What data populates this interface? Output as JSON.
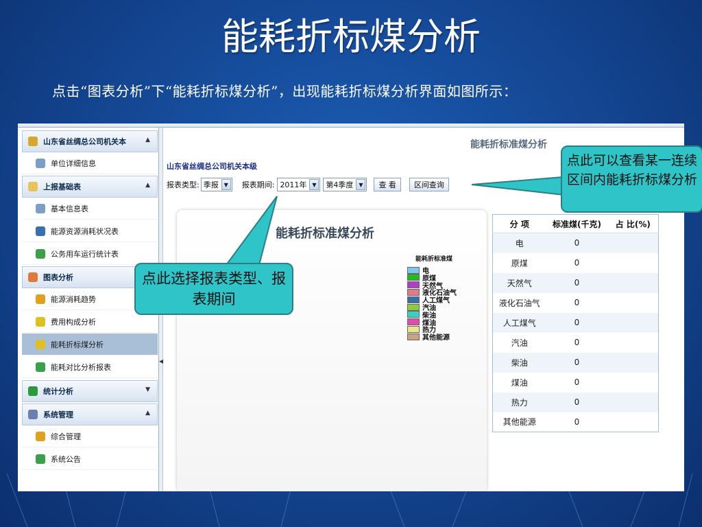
{
  "slide": {
    "title": "能耗折标煤分析",
    "subtitle": "点击“图表分析”下“能耗折标煤分析”，出现能耗折标煤分析界面如图所示："
  },
  "sidebar": {
    "sections": [
      {
        "label": "山东省丝绸总公司机关本",
        "caret": "▲",
        "icon_color": "#d7a92a",
        "items": [
          {
            "label": "单位详细信息",
            "icon_color": "#7aa0c8"
          }
        ]
      },
      {
        "label": "上报基础表",
        "caret": "▲",
        "icon_color": "#e8c35a",
        "items": [
          {
            "label": "基本信息表",
            "icon_color": "#7aa0c8"
          },
          {
            "label": "能源资源消耗状况表",
            "icon_color": "#3a6fb0"
          },
          {
            "label": "公务用车运行统计表",
            "icon_color": "#3aa04a"
          }
        ]
      },
      {
        "label": "图表分析",
        "caret": "",
        "icon_color": "#e07a3a",
        "items": [
          {
            "label": "能源消耗趋势",
            "icon_color": "#e0a020"
          },
          {
            "label": "费用构成分析",
            "icon_color": "#e0c020"
          },
          {
            "label": "能耗折标煤分析",
            "icon_color": "#e0c020",
            "active": true
          },
          {
            "label": "能耗对比分析报表",
            "icon_color": "#3aa04a"
          }
        ]
      },
      {
        "label": "统计分析",
        "caret": "▼",
        "icon_color": "#2a9a3a",
        "items": []
      },
      {
        "label": "系统管理",
        "caret": "▲",
        "icon_color": "#6a7fb0",
        "items": [
          {
            "label": "综合管理",
            "icon_color": "#e0a020"
          },
          {
            "label": "系统公告",
            "icon_color": "#3aa04a"
          }
        ]
      }
    ]
  },
  "main": {
    "header": "能耗折标准煤分析",
    "org_name": "山东省丝绸总公司机关本级",
    "form": {
      "type_label": "报表类型:",
      "type_value": "季报",
      "period_label": "报表期间:",
      "year_value": "2011年",
      "quarter_value": "第4季度",
      "view_button": "查 看",
      "range_button": "区间查询"
    },
    "chart_title": "能耗折标准煤分析"
  },
  "chart_data": {
    "type": "pie",
    "title": "能耗折标准煤分析",
    "legend_title": "能耗折标准煤",
    "legend_position": "right",
    "categories": [
      "电",
      "原煤",
      "天然气",
      "液化石油气",
      "人工煤气",
      "汽油",
      "柴油",
      "煤油",
      "热力",
      "其他能源"
    ],
    "values": [
      0,
      0,
      0,
      0,
      0,
      0,
      0,
      0,
      0,
      0
    ],
    "colors": [
      "#7ec8ee",
      "#22bb22",
      "#b03ec8",
      "#e07a86",
      "#3a6ea8",
      "#8ccc3a",
      "#3ad0c4",
      "#e84aa8",
      "#eee48a",
      "#c8a47e"
    ]
  },
  "table": {
    "headers": [
      "分 项",
      "标准煤(千克)",
      "占 比(%)"
    ],
    "rows": [
      [
        "电",
        "0",
        ""
      ],
      [
        "原煤",
        "0",
        ""
      ],
      [
        "天然气",
        "0",
        ""
      ],
      [
        "液化石油气",
        "0",
        ""
      ],
      [
        "人工煤气",
        "0",
        ""
      ],
      [
        "汽油",
        "0",
        ""
      ],
      [
        "柴油",
        "0",
        ""
      ],
      [
        "煤油",
        "0",
        ""
      ],
      [
        "热力",
        "0",
        ""
      ],
      [
        "其他能源",
        "0",
        ""
      ]
    ]
  },
  "callouts": {
    "right": "点此可以查看某一连续区间内能耗折标煤分析",
    "left": "点此选择报表类型、报表期间"
  }
}
